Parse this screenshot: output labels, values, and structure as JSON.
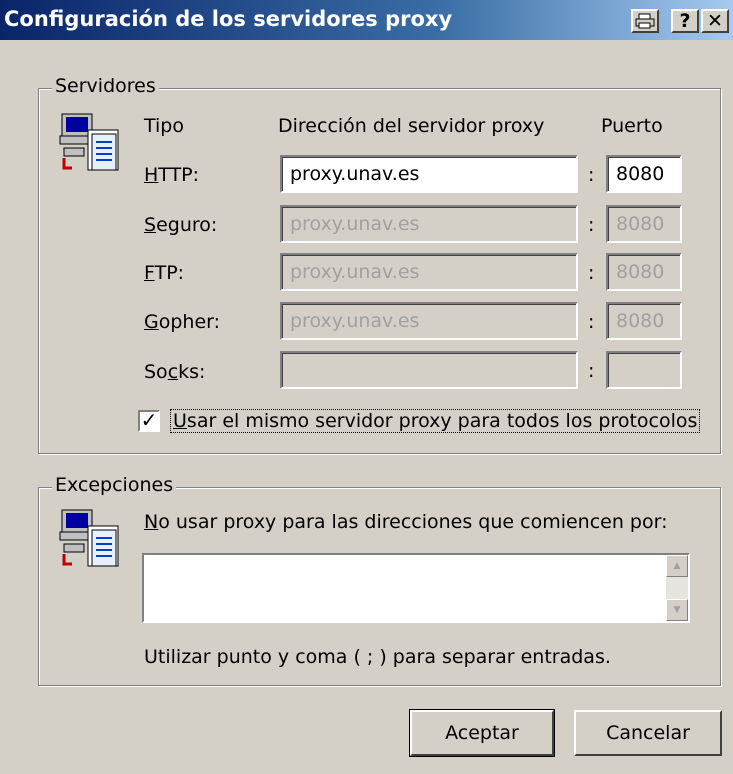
{
  "window": {
    "title": "Configuración de los servidores proxy",
    "buttons": {
      "print_icon": "printer-icon",
      "help_label": "?",
      "close_label": "✕"
    }
  },
  "servers": {
    "group_label": "Servidores",
    "icon": "network-computers-icon",
    "col_type": "Tipo",
    "col_address": "Dirección del servidor proxy",
    "col_port": "Puerto",
    "rows": [
      {
        "mnemonic": "H",
        "rest": "TTP:",
        "address": "proxy.unav.es",
        "port": "8080",
        "enabled": true
      },
      {
        "mnemonic": "S",
        "rest": "eguro:",
        "address": "proxy.unav.es",
        "port": "8080",
        "enabled": false
      },
      {
        "mnemonic": "F",
        "rest": "TP:",
        "address": "proxy.unav.es",
        "port": "8080",
        "enabled": false
      },
      {
        "mnemonic": "G",
        "rest": "opher:",
        "address": "proxy.unav.es",
        "port": "8080",
        "enabled": false
      },
      {
        "pre": "So",
        "mnemonic": "c",
        "rest": "ks:",
        "address": "",
        "port": "",
        "enabled": false
      }
    ],
    "colon": ":",
    "same_proxy": {
      "checked": true,
      "mnemonic": "U",
      "rest": "sar el mismo servidor proxy para todos los protocolos"
    }
  },
  "exceptions": {
    "group_label": "Excepciones",
    "icon": "network-computers-icon",
    "prompt_mnemonic": "N",
    "prompt_rest": "o usar proxy para las direcciones que comiencen por:",
    "value": "",
    "hint": "Utilizar punto y coma ( ; ) para separar entradas."
  },
  "footer": {
    "ok_label": "Aceptar",
    "cancel_label": "Cancelar"
  }
}
